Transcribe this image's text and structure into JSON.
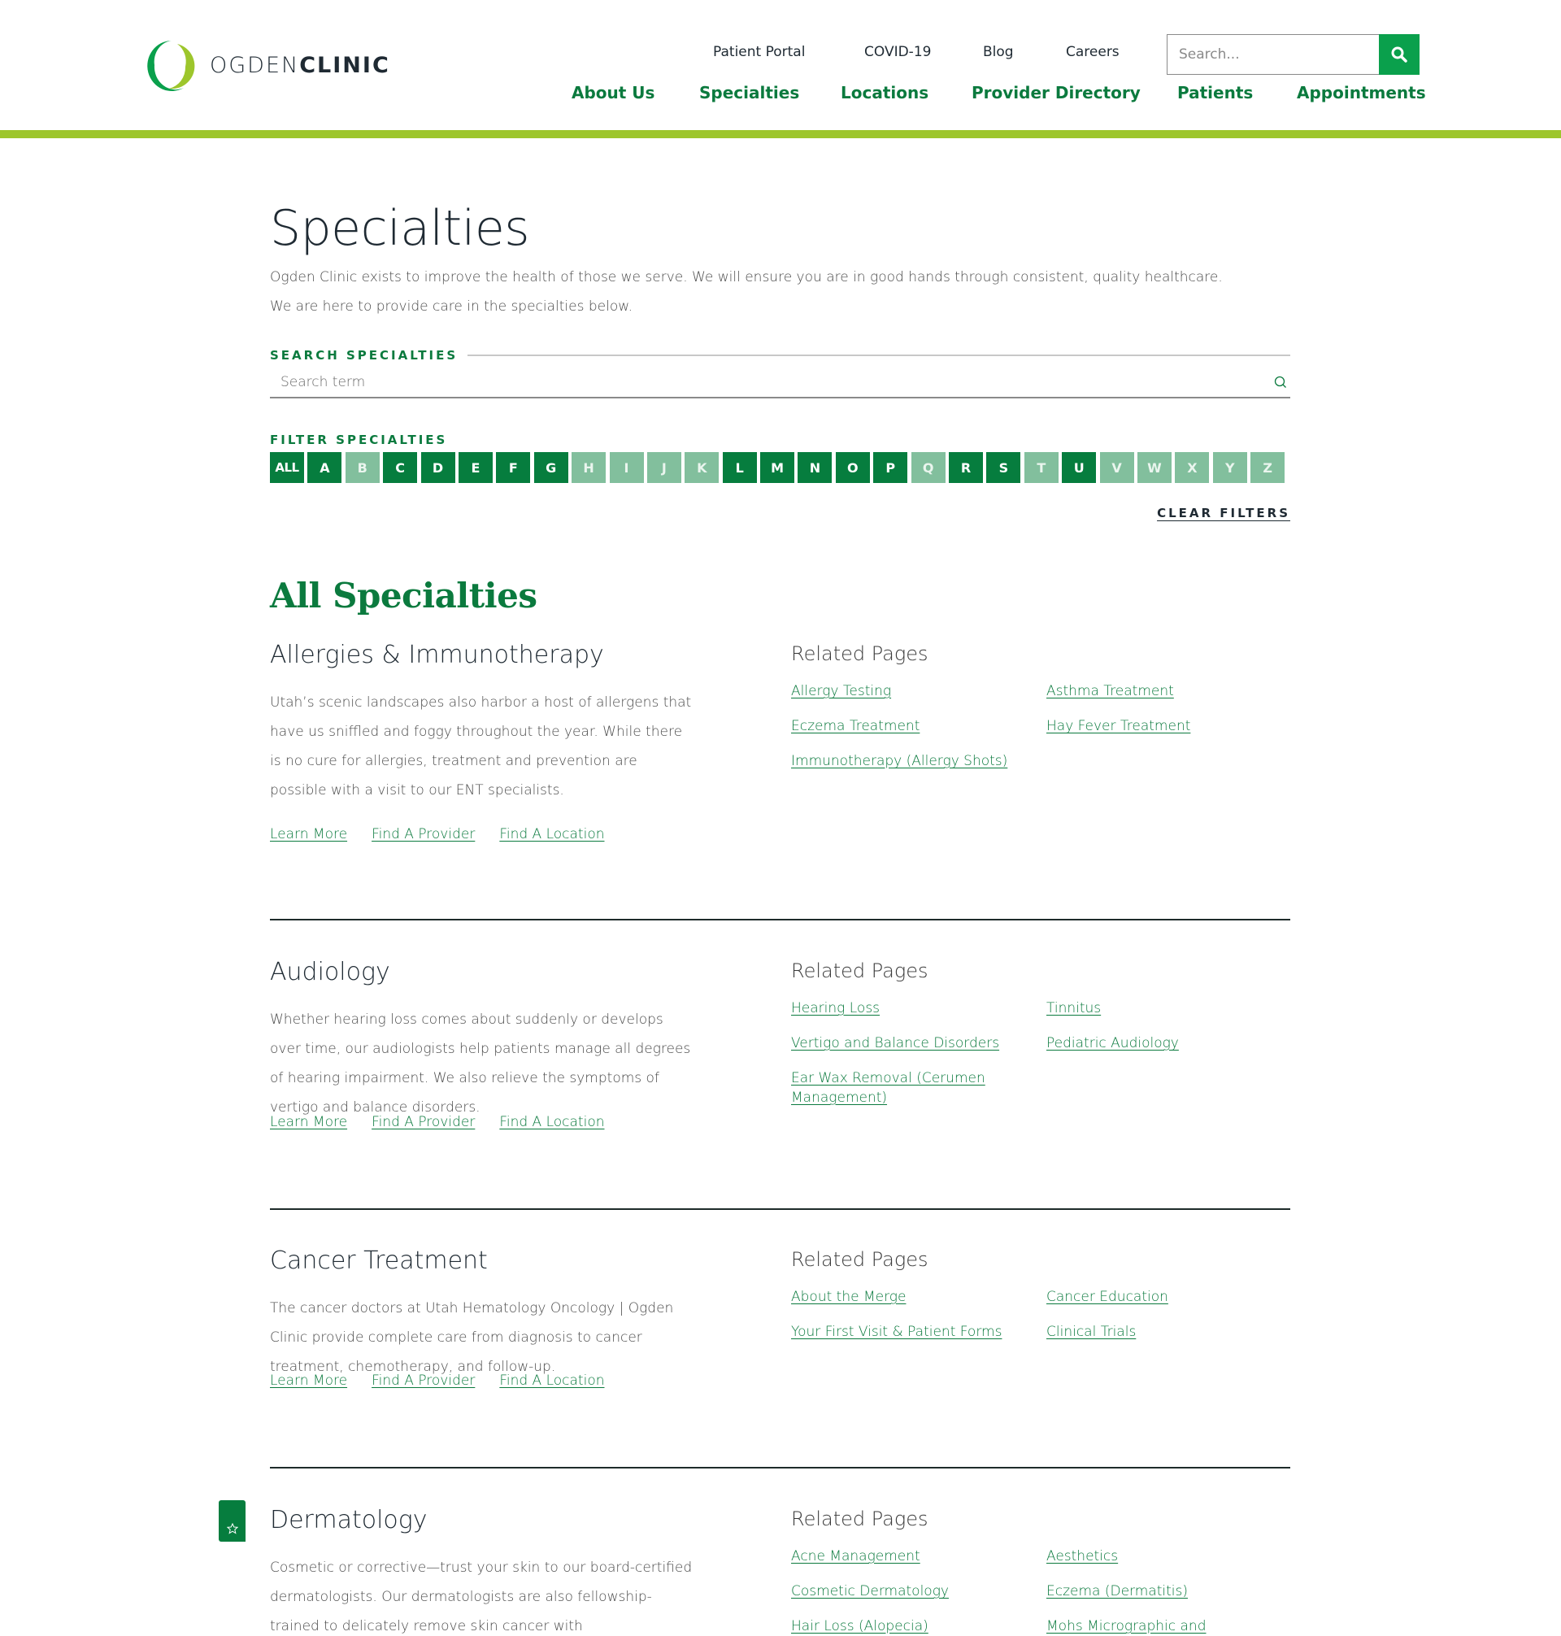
{
  "brand": {
    "name_light": "OGDEN",
    "name_bold": "CLINIC",
    "colors": {
      "primary_green": "#067d3e",
      "disabled_green": "#82bf9d",
      "accent_bar": "#9dc62c",
      "search_button": "#0aa04c",
      "text_dark": "#1f2a33"
    }
  },
  "header": {
    "utility_nav": [
      "Patient Portal",
      "COVID-19",
      "Blog",
      "Careers"
    ],
    "main_nav": [
      "About Us",
      "Specialties",
      "Locations",
      "Provider Directory",
      "Patients",
      "Appointments"
    ],
    "search": {
      "placeholder": "Search...",
      "value": "",
      "button_icon": "search-icon"
    }
  },
  "page": {
    "title": "Specialties",
    "intro_line1": "Ogden Clinic exists to improve the health of those we serve. We will ensure you are in good hands through consistent, quality healthcare.",
    "intro_line2": "We are here to provide care in the specialties below.",
    "search_label": "SEARCH SPECIALTIES",
    "search_placeholder": "Search term",
    "search_value": "",
    "filter_label": "FILTER SPECIALTIES",
    "filters": [
      {
        "label": "ALL",
        "enabled": true
      },
      {
        "label": "A",
        "enabled": true
      },
      {
        "label": "B",
        "enabled": false
      },
      {
        "label": "C",
        "enabled": true
      },
      {
        "label": "D",
        "enabled": true
      },
      {
        "label": "E",
        "enabled": true
      },
      {
        "label": "F",
        "enabled": true
      },
      {
        "label": "G",
        "enabled": true
      },
      {
        "label": "H",
        "enabled": false
      },
      {
        "label": "I",
        "enabled": false
      },
      {
        "label": "J",
        "enabled": false
      },
      {
        "label": "K",
        "enabled": false
      },
      {
        "label": "L",
        "enabled": true
      },
      {
        "label": "M",
        "enabled": true
      },
      {
        "label": "N",
        "enabled": true
      },
      {
        "label": "O",
        "enabled": true
      },
      {
        "label": "P",
        "enabled": true
      },
      {
        "label": "Q",
        "enabled": false
      },
      {
        "label": "R",
        "enabled": true
      },
      {
        "label": "S",
        "enabled": true
      },
      {
        "label": "T",
        "enabled": false
      },
      {
        "label": "U",
        "enabled": true
      },
      {
        "label": "V",
        "enabled": false
      },
      {
        "label": "W",
        "enabled": false
      },
      {
        "label": "X",
        "enabled": false
      },
      {
        "label": "Y",
        "enabled": false
      },
      {
        "label": "Z",
        "enabled": false
      }
    ],
    "clear_filters": "CLEAR FILTERS",
    "list_title": "All Specialties"
  },
  "specialties": [
    {
      "name": "Allergies & Immunotherapy",
      "description": "Utah’s scenic landscapes also harbor a host of allergens that have us sniffled and foggy throughout the year. While there is no cure for allergies, treatment and prevention are possible with a visit to our ENT specialists.",
      "actions": [
        "Learn More",
        "Find A Provider",
        "Find A Location"
      ],
      "related_title": "Related Pages",
      "related": [
        "Allergy Testing",
        "Asthma Treatment",
        "Eczema Treatment",
        "Hay Fever Treatment",
        "Immunotherapy (Allergy Shots)"
      ]
    },
    {
      "name": "Audiology",
      "description": "Whether hearing loss comes about suddenly or develops over time, our audiologists help patients manage all degrees of hearing impairment. We also relieve the symptoms of vertigo and balance disorders.",
      "actions": [
        "Learn More",
        "Find A Provider",
        "Find A Location"
      ],
      "related_title": "Related Pages",
      "related": [
        "Hearing Loss",
        "Tinnitus",
        "Vertigo and Balance Disorders",
        "Pediatric Audiology",
        "Ear Wax Removal (Cerumen Management)"
      ]
    },
    {
      "name": "Cancer Treatment",
      "description": "The cancer doctors at Utah Hematology Oncology | Ogden Clinic provide complete care from diagnosis to cancer treatment, chemotherapy, and follow-up.",
      "actions": [
        "Learn More",
        "Find A Provider",
        "Find A Location"
      ],
      "related_title": "Related Pages",
      "related": [
        "About the Merge",
        "Cancer Education",
        "Your First Visit & Patient Forms",
        "Clinical Trials"
      ]
    },
    {
      "name": "Dermatology",
      "description": "Cosmetic or corrective—trust your skin to our board-certified dermatologists. Our dermatologists are also fellowship-trained to delicately remove skin cancer with",
      "actions": [],
      "related_title": "Related Pages",
      "related": [
        "Acne Management",
        "Aesthetics",
        "Cosmetic Dermatology",
        "Eczema (Dermatitis)",
        "Hair Loss (Alopecia)",
        "Mohs Micrographic and"
      ]
    }
  ],
  "floating": {
    "favorite_icon": "star-icon"
  }
}
